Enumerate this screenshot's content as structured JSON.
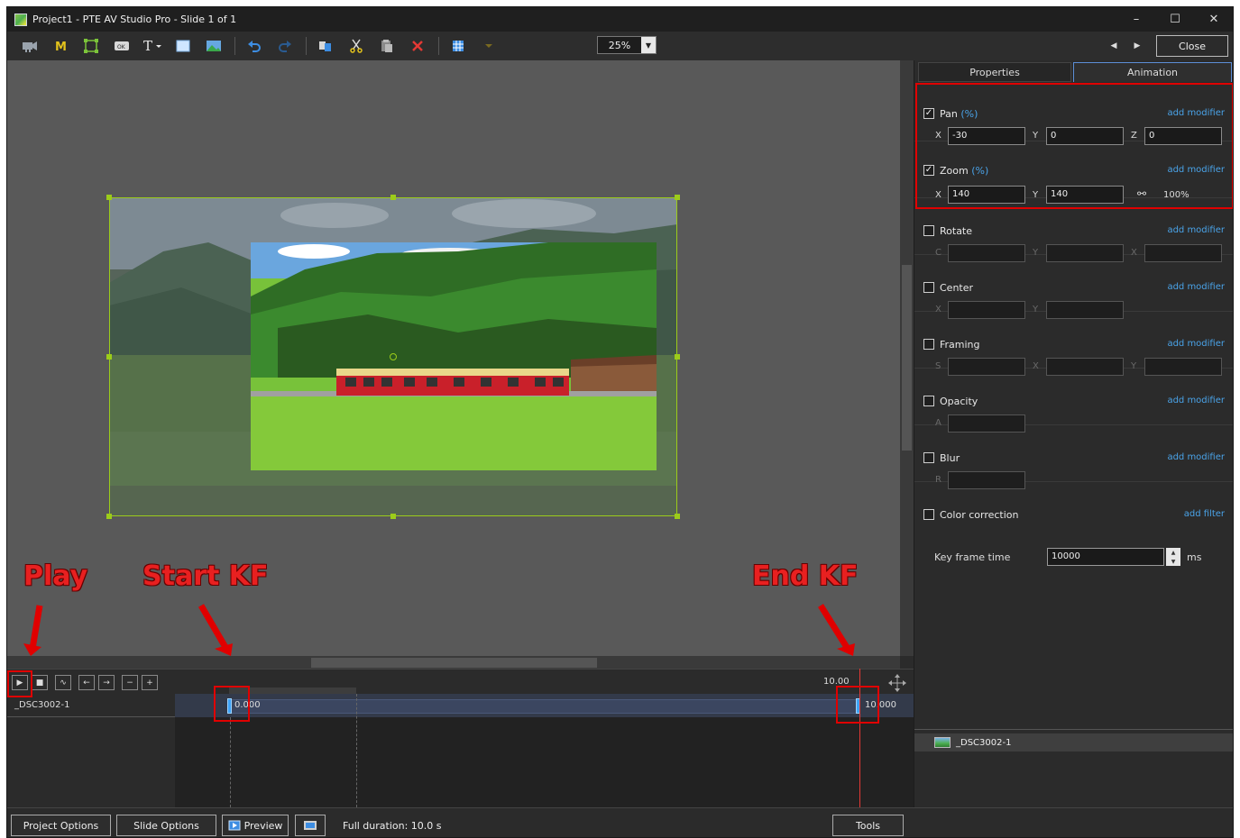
{
  "window": {
    "title": "Project1 - PTE AV Studio Pro - Slide 1 of 1",
    "minimize": "–",
    "maximize": "☐",
    "close": "✕"
  },
  "toolbar": {
    "zoom_value": "25%",
    "close_label": "Close"
  },
  "annotations": {
    "play": "Play",
    "start_kf": "Start KF",
    "end_kf": "End KF"
  },
  "timeline": {
    "track_name": "_DSC3002-1",
    "end_time_label": "10.00",
    "start_kf_label": "0.000",
    "end_kf_label": "10.000"
  },
  "panel": {
    "tabs": [
      "Properties",
      "Animation"
    ],
    "active_tab": "Animation",
    "add_modifier": "add modifier",
    "add_filter": "add filter",
    "pan": {
      "label": "Pan",
      "unit": "(%)",
      "checked": true,
      "x": "-30",
      "y": "0",
      "z": "0"
    },
    "zoom": {
      "label": "Zoom",
      "unit": "(%)",
      "checked": true,
      "x": "140",
      "y": "140",
      "link_value": "100%"
    },
    "rotate": {
      "label": "Rotate",
      "checked": false
    },
    "center": {
      "label": "Center",
      "checked": false
    },
    "framing": {
      "label": "Framing",
      "checked": false
    },
    "opacity": {
      "label": "Opacity",
      "checked": false
    },
    "blur": {
      "label": "Blur",
      "checked": false
    },
    "color_correction": {
      "label": "Color correction",
      "checked": false
    },
    "key_frame_time": {
      "label": "Key frame time",
      "value": "10000",
      "unit": "ms"
    },
    "object_item": "_DSC3002-1"
  },
  "axes": {
    "x": "X",
    "y": "Y",
    "z": "Z",
    "c": "C",
    "s": "S",
    "a": "A",
    "r": "R"
  },
  "bottom": {
    "project_options": "Project Options",
    "slide_options": "Slide Options",
    "preview": "Preview",
    "full_duration": "Full duration: 10.0 s",
    "tools": "Tools"
  },
  "colors": {
    "accent_blue": "#4aa3e8",
    "selection_green": "#9ccc1a",
    "annotation_red": "#e00000",
    "keyframe_blue": "#3fa3f7"
  }
}
